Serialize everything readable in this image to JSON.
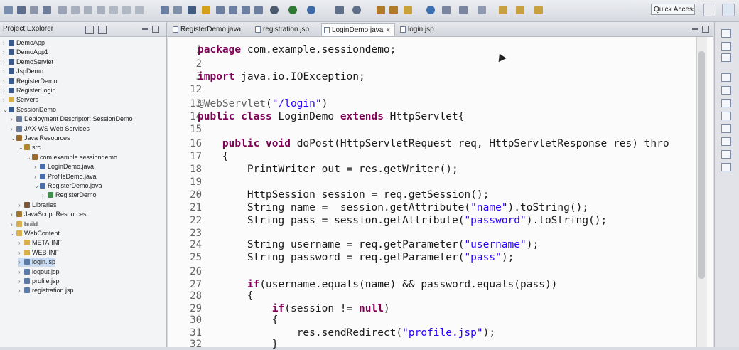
{
  "toolbar": {
    "quick_access_placeholder": "Quick Access",
    "icons": [
      "new-icon",
      "save-icon",
      "print-icon",
      "debug-icon",
      "run-icon",
      "search-icon",
      "perspective-icon"
    ]
  },
  "explorer": {
    "title": "Project Explorer",
    "items": [
      {
        "label": "DemoApp",
        "depth": 0,
        "icon": "project-icon"
      },
      {
        "label": "DemoApp1",
        "depth": 0,
        "icon": "project-icon"
      },
      {
        "label": "DemoServlet",
        "depth": 0,
        "icon": "project-icon"
      },
      {
        "label": "JspDemo",
        "depth": 0,
        "icon": "project-icon"
      },
      {
        "label": "RegisterDemo",
        "depth": 0,
        "icon": "project-icon"
      },
      {
        "label": "RegisterLogin",
        "depth": 0,
        "icon": "project-icon"
      },
      {
        "label": "Servers",
        "depth": 0,
        "icon": "folder-icon"
      },
      {
        "label": "SessionDemo",
        "depth": 0,
        "icon": "project-icon",
        "expanded": true
      },
      {
        "label": "Deployment Descriptor: SessionDemo",
        "depth": 1,
        "icon": "descriptor-icon"
      },
      {
        "label": "JAX-WS Web Services",
        "depth": 1,
        "icon": "ws-icon"
      },
      {
        "label": "Java Resources",
        "depth": 1,
        "icon": "java-resources-icon",
        "expanded": true
      },
      {
        "label": "src",
        "depth": 2,
        "icon": "source-folder-icon",
        "expanded": true
      },
      {
        "label": "com.example.sessiondemo",
        "depth": 3,
        "icon": "package-icon",
        "expanded": true
      },
      {
        "label": "LoginDemo.java",
        "depth": 4,
        "icon": "java-file-icon"
      },
      {
        "label": "ProfileDemo.java",
        "depth": 4,
        "icon": "java-file-icon"
      },
      {
        "label": "RegisterDemo.java",
        "depth": 4,
        "icon": "java-file-icon",
        "expanded": true
      },
      {
        "label": "RegisterDemo",
        "depth": 5,
        "icon": "class-icon"
      },
      {
        "label": "Libraries",
        "depth": 2,
        "icon": "library-icon"
      },
      {
        "label": "JavaScript Resources",
        "depth": 1,
        "icon": "js-icon"
      },
      {
        "label": "build",
        "depth": 1,
        "icon": "folder-icon"
      },
      {
        "label": "WebContent",
        "depth": 1,
        "icon": "folder-icon",
        "expanded": true
      },
      {
        "label": "META-INF",
        "depth": 2,
        "icon": "folder-icon"
      },
      {
        "label": "WEB-INF",
        "depth": 2,
        "icon": "folder-icon"
      },
      {
        "label": "login.jsp",
        "depth": 2,
        "icon": "jsp-file-icon",
        "selected": true
      },
      {
        "label": "logout.jsp",
        "depth": 2,
        "icon": "jsp-file-icon"
      },
      {
        "label": "profile.jsp",
        "depth": 2,
        "icon": "jsp-file-icon"
      },
      {
        "label": "registration.jsp",
        "depth": 2,
        "icon": "jsp-file-icon"
      }
    ]
  },
  "editor": {
    "tabs": [
      {
        "label": "RegisterDemo.java",
        "active": false
      },
      {
        "label": "registration.jsp",
        "active": false
      },
      {
        "label": "LoginDemo.java",
        "active": true
      },
      {
        "label": "login.jsp",
        "active": false
      }
    ],
    "lines": [
      {
        "n": "1",
        "text": "package com.example.sessiondemo;"
      },
      {
        "n": "2",
        "text": ""
      },
      {
        "n": "3",
        "text": "import java.io.IOException;"
      },
      {
        "n": "12",
        "text": ""
      },
      {
        "n": "13",
        "text": "@WebServlet(\"/login\")"
      },
      {
        "n": "14",
        "text": "public class LoginDemo extends HttpServlet{"
      },
      {
        "n": "15",
        "text": ""
      },
      {
        "n": "16",
        "text": "    public void doPost(HttpServletRequest req, HttpServletResponse res) thro"
      },
      {
        "n": "17",
        "text": "    {"
      },
      {
        "n": "18",
        "text": "        PrintWriter out = res.getWriter();"
      },
      {
        "n": "19",
        "text": ""
      },
      {
        "n": "20",
        "text": "        HttpSession session = req.getSession();"
      },
      {
        "n": "21",
        "text": "        String name =  session.getAttribute(\"name\").toString();"
      },
      {
        "n": "22",
        "text": "        String pass = session.getAttribute(\"password\").toString();"
      },
      {
        "n": "23",
        "text": ""
      },
      {
        "n": "24",
        "text": "        String username = req.getParameter(\"username\");"
      },
      {
        "n": "25",
        "text": "        String password = req.getParameter(\"pass\");"
      },
      {
        "n": "26",
        "text": ""
      },
      {
        "n": "27",
        "text": "        if(username.equals(name) && password.equals(pass))"
      },
      {
        "n": "28",
        "text": "        {"
      },
      {
        "n": "29",
        "text": "            if(session != null)"
      },
      {
        "n": "30",
        "text": "            {"
      },
      {
        "n": "31",
        "text": "                res.sendRedirect(\"profile.jsp\");"
      },
      {
        "n": "32",
        "text": "            }"
      }
    ]
  },
  "colors": {
    "keyword": "#7f0055",
    "string": "#2a00ff",
    "annotation": "#646464",
    "field": "#0000c0",
    "selection": "#c9dcf3"
  }
}
